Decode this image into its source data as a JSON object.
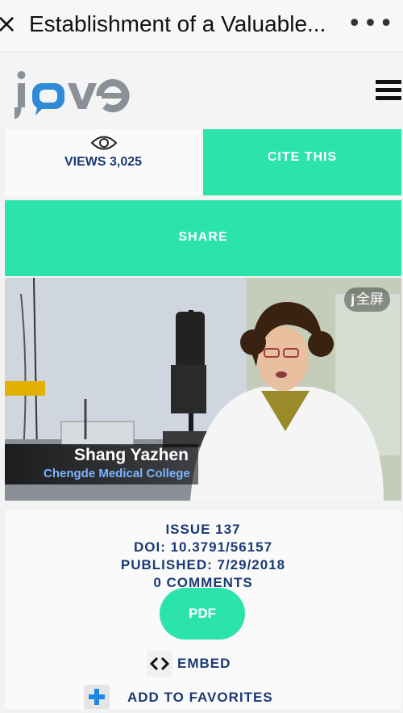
{
  "browser": {
    "title": "Establishment of a Valuable...",
    "close_glyph": "×",
    "more_glyph": "⋮"
  },
  "header": {
    "logo_text": "jove",
    "menu_icon": "hamburger-icon"
  },
  "stats": {
    "views_label": "VIEWS 3,025",
    "cite_label": "CITE THIS",
    "share_label": "SHARE"
  },
  "video": {
    "fullscreen_label": "全屏",
    "speaker_name": "Shang Yazhen",
    "speaker_affiliation": "Chengde Medical College"
  },
  "article": {
    "issue": "ISSUE 137",
    "doi": "DOI: 10.3791/56157",
    "published": "PUBLISHED: 7/29/2018",
    "comments": "0 COMMENTS",
    "pdf_label": "PDF",
    "embed_label": "EMBED",
    "favorites_label": "ADD TO FAVORITES"
  },
  "colors": {
    "accent": "#2de3ac",
    "navy": "#1b3a73",
    "logo_grey": "#8a9097",
    "logo_blue": "#2f8bd6"
  }
}
